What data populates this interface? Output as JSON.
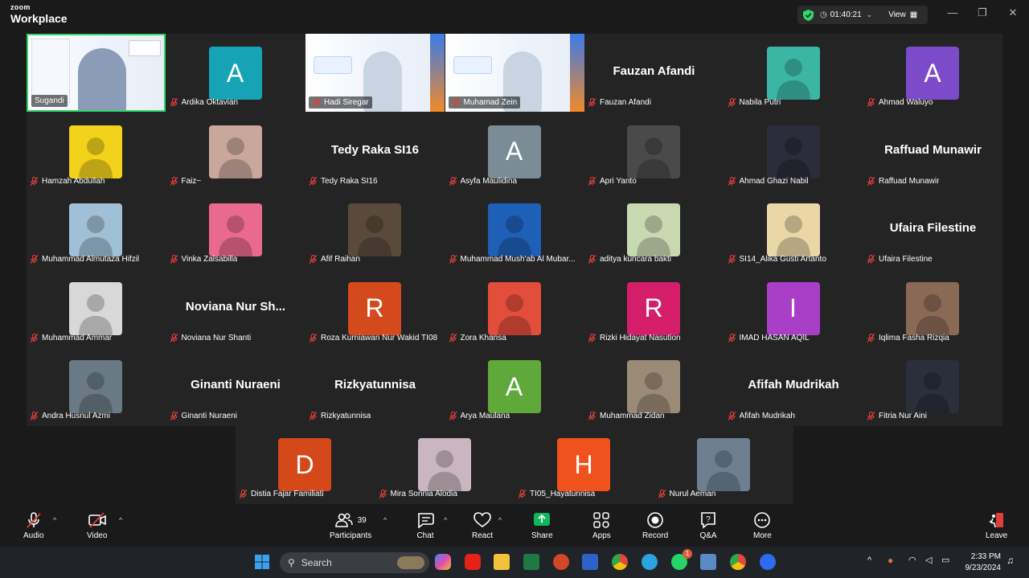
{
  "app": {
    "brand_top": "zoom",
    "brand_bottom": "Workplace",
    "timer": "01:40:21",
    "view_label": "View"
  },
  "colors": {
    "active_speaker": "#2fd86a",
    "muted_mic": "#e0403a",
    "share": "#0fb85a"
  },
  "participants": [
    {
      "name": "Sugandi",
      "type": "video",
      "boxed": true,
      "muted": false,
      "active": true
    },
    {
      "name": "Ardika Oktavian",
      "type": "avatar",
      "letter": "A",
      "color": "#16a3b5",
      "muted": true
    },
    {
      "name": "Hadi Siregar",
      "type": "video",
      "boxed": true,
      "muted": true
    },
    {
      "name": "Muhamad Zein",
      "type": "video",
      "boxed": true,
      "muted": true
    },
    {
      "name": "Fauzan Afandi",
      "type": "text",
      "display": "Fauzan Afandi",
      "muted": true
    },
    {
      "name": "Nabila Putri",
      "type": "photo",
      "color": "#3bb6a5",
      "muted": true
    },
    {
      "name": "Ahmad Waluyo",
      "type": "avatar",
      "letter": "A",
      "color": "#7b4bc9",
      "muted": true
    },
    {
      "name": "Hamzah Abdullah",
      "type": "photo",
      "color": "#f2d21b",
      "muted": true
    },
    {
      "name": "Faiz~",
      "type": "photo",
      "color": "#c9a79b",
      "muted": true
    },
    {
      "name": "Tedy Raka SI16",
      "type": "text",
      "display": "Tedy Raka SI16",
      "muted": true
    },
    {
      "name": "Asyfa Maulidina",
      "type": "avatar",
      "letter": "A",
      "color": "#7a8c96",
      "muted": true
    },
    {
      "name": "Apri Yanto",
      "type": "photo",
      "color": "#4a4a4a",
      "muted": true
    },
    {
      "name": "Ahmad Ghazi Nabil",
      "type": "photo",
      "color": "#2c2c3a",
      "muted": true
    },
    {
      "name": "Raffuad Munawir",
      "type": "text",
      "display": "Raffuad Munawir",
      "muted": true
    },
    {
      "name": "Muhammad Almutaza Hifzil",
      "type": "photo",
      "color": "#9fc0d6",
      "muted": true
    },
    {
      "name": "Vinka Zalsabilla",
      "type": "photo",
      "color": "#e96a8c",
      "muted": true
    },
    {
      "name": "Afif Raihan",
      "type": "photo",
      "color": "#5a4a3a",
      "muted": true
    },
    {
      "name": "Muhammad Mush'ab Al Mubar...",
      "type": "photo",
      "color": "#1e5fb8",
      "muted": true
    },
    {
      "name": "aditya kuncara bakti",
      "type": "photo",
      "color": "#c8d8b0",
      "muted": true
    },
    {
      "name": "SI14_Alika Gusti Artanto",
      "type": "photo",
      "color": "#e9d7a7",
      "muted": true
    },
    {
      "name": "Ufaira Filestine",
      "type": "text",
      "display": "Ufaira Filestine",
      "muted": true
    },
    {
      "name": "Muhammad Ammar",
      "type": "photo",
      "color": "#d8d8d8",
      "muted": true
    },
    {
      "name": "Noviana Nur Shanti",
      "type": "text",
      "display": "Noviana Nur Sh...",
      "muted": true
    },
    {
      "name": "Roza Kurniawan Nur Wakid TI08",
      "type": "avatar",
      "letter": "R",
      "color": "#d44a1c",
      "muted": true
    },
    {
      "name": "Zora Khansa",
      "type": "photo",
      "color": "#e24e3a",
      "muted": true
    },
    {
      "name": "Rizki Hidayat Nasution",
      "type": "avatar",
      "letter": "R",
      "color": "#d41e6a",
      "muted": true
    },
    {
      "name": "IMAD HASAN AQIL",
      "type": "avatar",
      "letter": "I",
      "color": "#a93fc7",
      "muted": true
    },
    {
      "name": "Iqlima Fasha Rizqia",
      "type": "photo",
      "color": "#8a6a55",
      "muted": true
    },
    {
      "name": "Andra Husnul Azmi",
      "type": "photo",
      "color": "#6a7a85",
      "muted": true
    },
    {
      "name": "Ginanti Nuraeni",
      "type": "text",
      "display": "Ginanti Nuraeni",
      "muted": true
    },
    {
      "name": "Rizkyatunnisa",
      "type": "text",
      "display": "Rizkyatunnisa",
      "muted": true
    },
    {
      "name": "Arya Maulana",
      "type": "avatar",
      "letter": "A",
      "color": "#5fa83a",
      "muted": true
    },
    {
      "name": "Muhammad Zidan",
      "type": "photo",
      "color": "#9a8a76",
      "muted": true
    },
    {
      "name": "Afifah Mudrikah",
      "type": "text",
      "display": "Afifah Mudrikah",
      "muted": true
    },
    {
      "name": "Fitria Nur Aini",
      "type": "photo",
      "color": "#2b2f3a",
      "muted": true
    }
  ],
  "last_row": [
    {
      "name": "Distia Fajar Familiati",
      "type": "avatar",
      "letter": "D",
      "color": "#d4481a",
      "muted": true
    },
    {
      "name": "Mira Sonnia Alodia",
      "type": "photo",
      "color": "#c9b6c0",
      "muted": true
    },
    {
      "name": "TI05_Hayatunnisa",
      "type": "avatar",
      "letter": "H",
      "color": "#f0521e",
      "muted": true
    },
    {
      "name": "Nurul Aeman",
      "type": "photo",
      "color": "#6e7f92",
      "muted": true
    }
  ],
  "toolbar": {
    "audio": "Audio",
    "video": "Video",
    "participants": "Participants",
    "participant_count": "39",
    "chat": "Chat",
    "react": "React",
    "share": "Share",
    "apps": "Apps",
    "record": "Record",
    "qa": "Q&A",
    "more": "More",
    "leave": "Leave"
  },
  "taskbar": {
    "search": "Search",
    "time": "2:33 PM",
    "date": "9/23/2024",
    "whatsapp_badge": "1"
  }
}
